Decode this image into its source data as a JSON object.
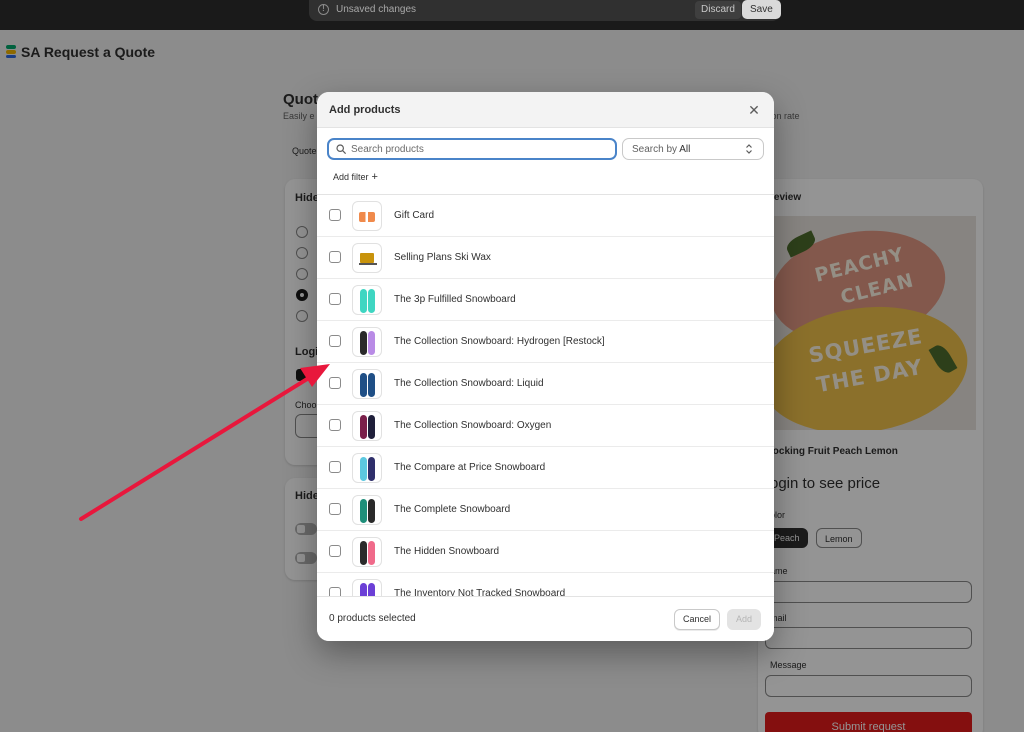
{
  "savebar": {
    "unsaved_text": "Unsaved changes",
    "discard_label": "Discard",
    "save_label": "Save"
  },
  "app": {
    "title": "SA Request a Quote"
  },
  "background": {
    "heading": "Quot",
    "subtitle": "Easily e",
    "subtitle_right": "sion rate",
    "tab": "Quote",
    "card1_title": "Hide",
    "login_title": "Logi",
    "choose_label": "Choo",
    "card2_title": "Hide"
  },
  "preview": {
    "title": "review",
    "product_name": "locking Fruit Peach Lemon",
    "price_text": "ogin to see price",
    "color_label": "olor",
    "chip_peach": "Peach",
    "chip_lemon": "Lemon",
    "name_label": "ame",
    "email_label": "mail",
    "message_label": "Message",
    "submit_label": "Submit request",
    "rug_text_1": "PEACHY",
    "rug_text_2": "CLEAN",
    "rug_text_3": "SQUEEZE",
    "rug_text_4": "THE DAY"
  },
  "modal": {
    "title": "Add products",
    "search": {
      "placeholder": "Search products",
      "value": ""
    },
    "search_by": {
      "prefix": "Search by",
      "value": "All"
    },
    "add_filter_label": "Add filter",
    "products": [
      {
        "name": "Gift Card",
        "thumb": "gift-card"
      },
      {
        "name": "Selling Plans Ski Wax",
        "thumb": "ski-wax"
      },
      {
        "name": "The 3p Fulfilled Snowboard",
        "thumb": "snowboard",
        "colors": [
          "#3fd6c2",
          "#3fd6c2"
        ]
      },
      {
        "name": "The Collection Snowboard: Hydrogen [Restock]",
        "thumb": "snowboard",
        "colors": [
          "#2b2b2b",
          "#b98be6"
        ]
      },
      {
        "name": "The Collection Snowboard: Liquid",
        "thumb": "snowboard",
        "colors": [
          "#1f4f86",
          "#1f4f86"
        ]
      },
      {
        "name": "The Collection Snowboard: Oxygen",
        "thumb": "snowboard",
        "colors": [
          "#7a1f4a",
          "#1f1f3a"
        ]
      },
      {
        "name": "The Compare at Price Snowboard",
        "thumb": "snowboard",
        "colors": [
          "#5cc8e0",
          "#2f2f6b"
        ]
      },
      {
        "name": "The Complete Snowboard",
        "thumb": "snowboard",
        "colors": [
          "#1f8f7a",
          "#2a2a2a"
        ]
      },
      {
        "name": "The Hidden Snowboard",
        "thumb": "snowboard",
        "colors": [
          "#2b2b2b",
          "#f06a8a"
        ]
      },
      {
        "name": "The Inventory Not Tracked Snowboard",
        "thumb": "snowboard",
        "colors": [
          "#6b3fd6",
          "#6b3fd6"
        ]
      }
    ],
    "footer": {
      "selected_text": "0 products selected",
      "cancel_label": "Cancel",
      "add_label": "Add"
    }
  },
  "colors": {
    "accent_focus": "#4a84c9",
    "annotation_arrow": "#e8173c",
    "submit_button": "#e31b1b"
  }
}
